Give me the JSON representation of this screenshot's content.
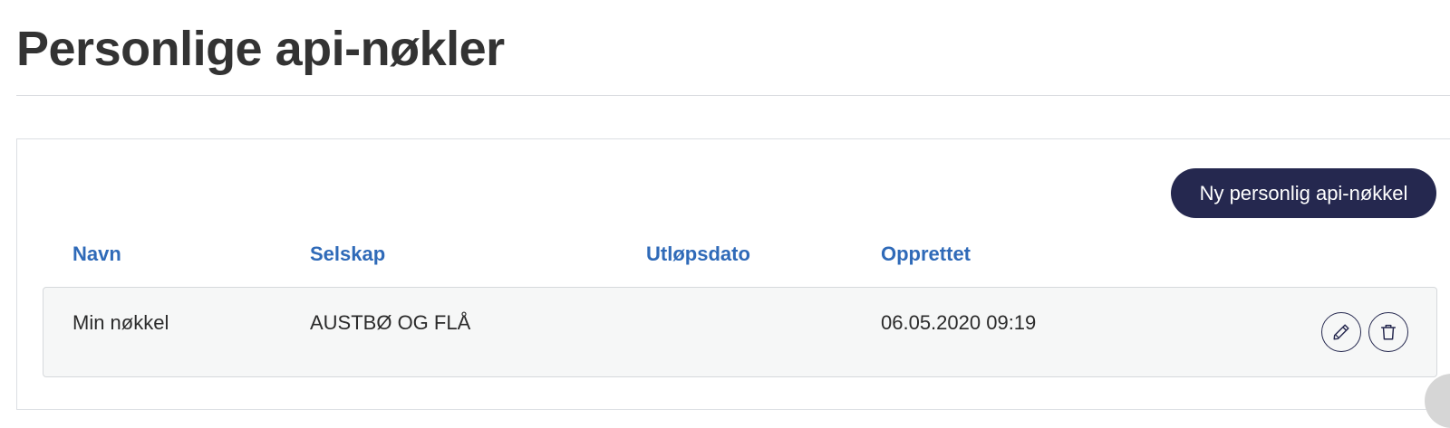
{
  "page": {
    "title": "Personlige api-nøkler"
  },
  "toolbar": {
    "new_key_label": "Ny personlig api-nøkkel"
  },
  "table": {
    "headers": {
      "name": "Navn",
      "company": "Selskap",
      "expiry": "Utløpsdato",
      "created": "Opprettet"
    },
    "rows": [
      {
        "name": "Min nøkkel",
        "company": "AUSTBØ OG FLÅ",
        "expiry": "",
        "created": "06.05.2020 09:19",
        "actions": [
          "pencil-icon",
          "trash-icon"
        ]
      }
    ]
  },
  "colors": {
    "accent": "#25284f",
    "header_link": "#2f6ab8",
    "row_background": "#f6f7f7"
  }
}
